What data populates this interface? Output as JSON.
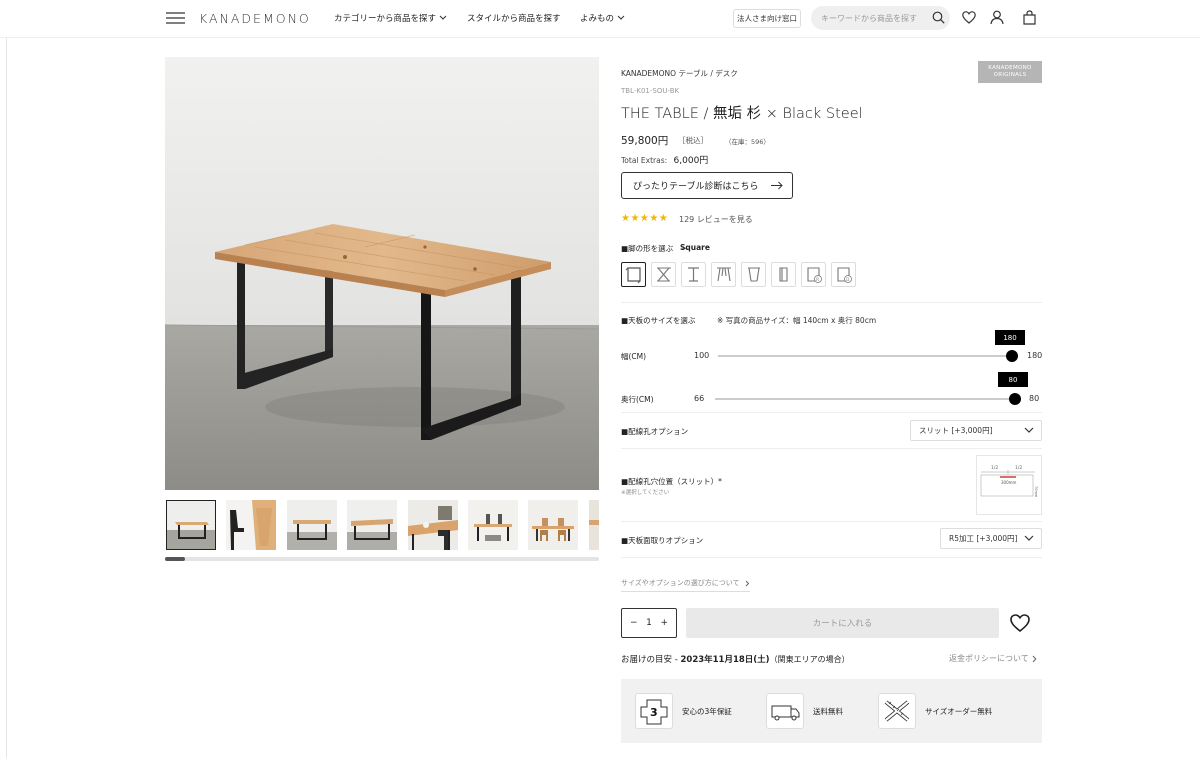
{
  "header": {
    "logo": "KANADEMONO",
    "nav": [
      {
        "label": "カテゴリーから商品を探す",
        "has_chevron": true
      },
      {
        "label": "スタイルから商品を探す",
        "has_chevron": false
      },
      {
        "label": "よみもの",
        "has_chevron": true
      }
    ],
    "corporate_label": "法人さま向け窓口",
    "search_placeholder": "キーワードから商品を探す"
  },
  "gallery": {
    "thumbnail_count": 8,
    "active_index": 0
  },
  "product": {
    "breadcrumb": "KANADEMONO  テーブル / デスク",
    "badge_line1": "KANADEMONO",
    "badge_line2": "ORIGINALS",
    "sku": "TBL-K01-SOU-BK",
    "title": "THE TABLE / 無垢 杉 × Black Steel",
    "price": "59,800円",
    "tax_label": "［税込］",
    "stock": "（在庫：596）",
    "extras_label": "Total Extras:",
    "extras_value": "6,000円",
    "diagnosis_button": "ぴったりテーブル診断はこちら",
    "stars": "★★★★★",
    "rating": 5,
    "reviews_text": "129 レビューを見る"
  },
  "leg_shape": {
    "label": "■脚の形を選ぶ　—",
    "selected": "Square",
    "options": [
      "square-leg-icon",
      "x-leg-icon",
      "i-leg-icon",
      "a-leg-icon",
      "taper-leg-icon",
      "bar-leg-icon",
      "round-r-leg-icon",
      "round-d-leg-icon"
    ],
    "active_index": 0
  },
  "size": {
    "label": "■天板のサイズを選ぶ",
    "note": "※ 写真の商品サイズ：幅 140cm x 奥行 80cm",
    "width": {
      "label": "幅(CM)",
      "min": "100",
      "max": "180",
      "value": "180",
      "fraction": 1.0
    },
    "depth": {
      "label": "奥行(CM)",
      "min": "66",
      "max": "80",
      "value": "80",
      "fraction": 1.0
    }
  },
  "options": {
    "wiring_hole_label": "■配線孔オプション",
    "wiring_hole_value": "スリット [+3,000円]",
    "wiring_position_label": "■配線孔穴位置（スリット）*",
    "wiring_position_note": "※選択してください",
    "slit_diagram": {
      "left": "1/2",
      "right": "1/2",
      "width_label": "300mm",
      "depth_label": "70mm"
    },
    "chamfer_label": "■天板面取りオプション",
    "chamfer_value": "R5加工 [+3,000円]"
  },
  "guide_link": "サイズやオプションの選び方について",
  "purchase": {
    "qty": "1",
    "minus": "−",
    "plus": "+",
    "cart_label": "カートに入れる"
  },
  "delivery": {
    "prefix": "お届けの目安 - ",
    "date": "2023年11月18日(土)",
    "suffix": "（関東エリアの場合）",
    "policy": "返金ポリシーについて"
  },
  "features": [
    {
      "label": "安心の3年保証",
      "icon": "warranty-3yr-icon"
    },
    {
      "label": "送料無料",
      "icon": "truck-icon"
    },
    {
      "label": "サイズオーダー無料",
      "icon": "size-order-icon"
    }
  ]
}
